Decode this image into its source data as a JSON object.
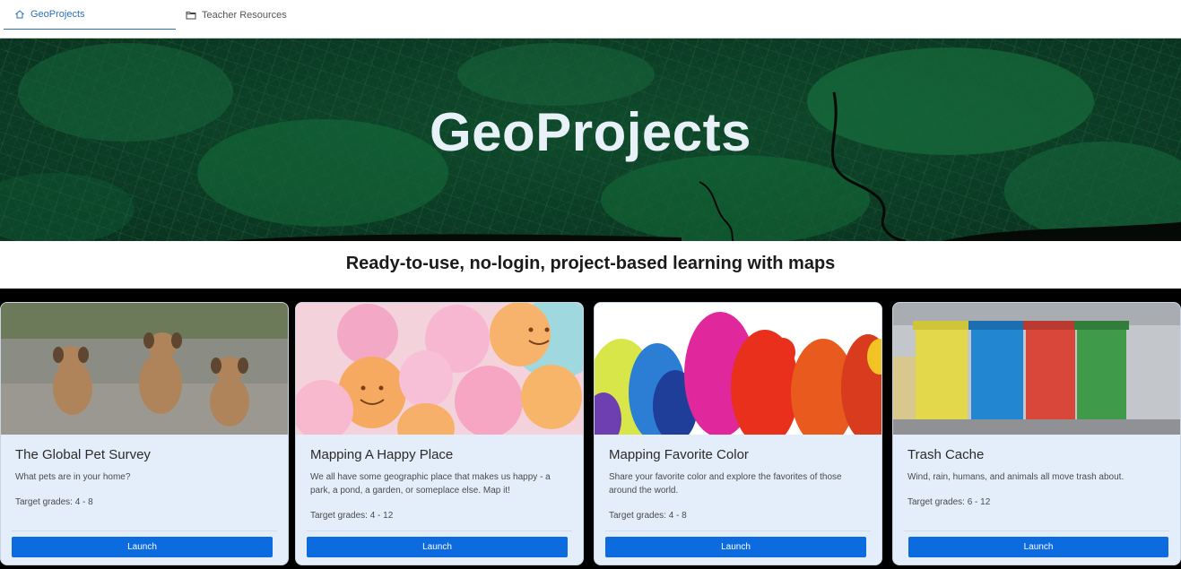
{
  "tabs": [
    {
      "label": "GeoProjects",
      "icon": "home-icon",
      "active": true
    },
    {
      "label": "Teacher Resources",
      "icon": "folder-icon",
      "active": false
    }
  ],
  "hero": {
    "title": "GeoProjects"
  },
  "subtitle": "Ready-to-use, no-login, project-based learning with maps",
  "colors": {
    "accent": "#0d6be0",
    "tab_active": "#2a6ebb",
    "card_bg": "#e4eefa",
    "hero_bg": "#0d3a24"
  },
  "cards": [
    {
      "title": "The Global Pet Survey",
      "description": "What pets are in your home?",
      "grades": "Target grades: 4 - 8",
      "button": "Launch",
      "image": "puppies-photo"
    },
    {
      "title": "Mapping A Happy Place",
      "description": "We all have some geographic place that makes us happy - a park, a pond, a garden, or someplace else.  Map it!",
      "grades": "Target grades: 4 - 12",
      "button": "Launch",
      "image": "balloons-photo"
    },
    {
      "title": "Mapping Favorite Color",
      "description": "Share your favorite color and explore the favorites of those around the world.",
      "grades": "Target grades: 4 - 8",
      "button": "Launch",
      "image": "colorful-silhouettes-photo"
    },
    {
      "title": "Trash Cache",
      "description": "Wind, rain, humans, and animals all move trash about.",
      "grades": "Target grades: 6 - 12",
      "button": "Launch",
      "image": "trash-bins-photo"
    }
  ]
}
